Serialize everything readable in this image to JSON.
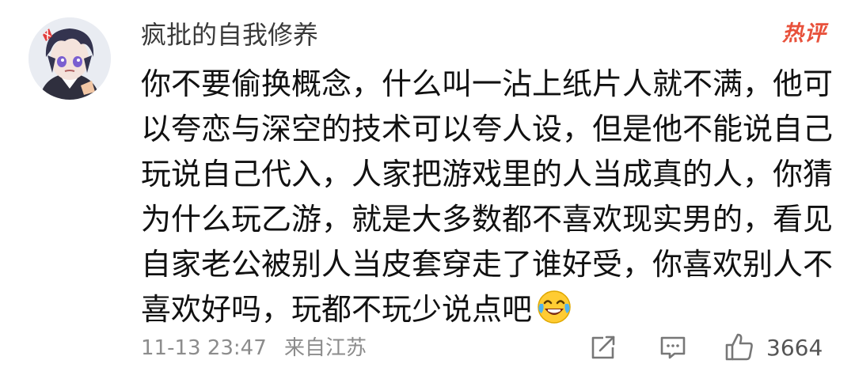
{
  "comment": {
    "username": "疯批的自我修养",
    "hot_badge": "热评",
    "lines": [
      "你不要偷换概念，什么叫一沾上纸片人就不满，他可",
      "以夸恋与深空的技术可以夸人设，但是他不能说自己",
      "玩说自己代入，人家把游戏里的人当成真的人，你猜",
      "为什么玩乙游，就是大多数都不喜欢现实男的，看见",
      "自家老公被别人当皮套穿走了谁好受，你喜欢别人不",
      "喜欢好吗，玩都不玩少说点吧"
    ],
    "trailing_emoji": "laugh-cry-icon",
    "time": "11-13 23:47",
    "location": "来自江苏",
    "likes": "3664"
  },
  "icons": {
    "share": "share-icon",
    "comment": "comment-icon",
    "like": "thumbs-up-icon"
  },
  "colors": {
    "hot_badge": "#e8513b",
    "username": "#3a3a3a",
    "body_text": "#111111",
    "meta_text": "#8c8c8c"
  }
}
